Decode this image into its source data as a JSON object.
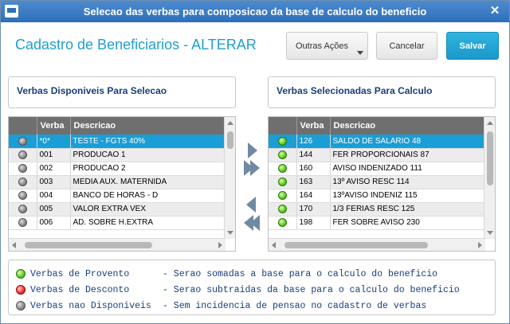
{
  "window": {
    "title": "Selecao das verbas para composicao da base de calculo do beneficio",
    "close_glyph": "✕"
  },
  "header": {
    "title": "Cadastro de Beneficiarios - ALTERAR"
  },
  "buttons": {
    "outras_acoes": "Outras Ações",
    "cancelar": "Cancelar",
    "salvar": "Salvar"
  },
  "left_panel": {
    "label": "Verbas Disponiveis Para Selecao",
    "columns": [
      "",
      "Verba",
      "Descricao"
    ],
    "rows": [
      {
        "status": "gray",
        "verba": "*0*",
        "descricao": "TESTE - FGTS 40%",
        "selected": true
      },
      {
        "status": "gray",
        "verba": "001",
        "descricao": "PRODUCAO 1"
      },
      {
        "status": "gray",
        "verba": "002",
        "descricao": "PRODUCAO 2"
      },
      {
        "status": "gray",
        "verba": "003",
        "descricao": "MEDIA AUX. MATERNIDA"
      },
      {
        "status": "gray",
        "verba": "004",
        "descricao": "BANCO DE HORAS - D"
      },
      {
        "status": "gray",
        "verba": "005",
        "descricao": "VALOR EXTRA VEX"
      },
      {
        "status": "gray",
        "verba": "006",
        "descricao": "AD. SOBRE H.EXTRA"
      }
    ]
  },
  "right_panel": {
    "label": "Verbas Selecionadas Para Calculo",
    "columns": [
      "",
      "Verba",
      "Descricao"
    ],
    "rows": [
      {
        "status": "green",
        "verba": "126",
        "descricao": "SALDO DE SALARIO 48",
        "selected": true
      },
      {
        "status": "green",
        "verba": "144",
        "descricao": "FER PROPORCIONAIS 87"
      },
      {
        "status": "green",
        "verba": "160",
        "descricao": "AVISO INDENIZADO 111"
      },
      {
        "status": "green",
        "verba": "163",
        "descricao": "13º AVISO RESC 114"
      },
      {
        "status": "green",
        "verba": "164",
        "descricao": "13ºAVISO INDENIZ 115"
      },
      {
        "status": "green",
        "verba": "170",
        "descricao": "1/3 FERIAS RESC 125"
      },
      {
        "status": "green",
        "verba": "198",
        "descricao": "FER SOBRE AVISO 230"
      }
    ]
  },
  "movers": [
    "add-one",
    "add-all",
    "remove-one",
    "remove-all"
  ],
  "legend": [
    {
      "color": "green",
      "name": "Verbas de Provento",
      "desc": "- Serao somadas a base para o calculo do beneficio"
    },
    {
      "color": "red",
      "name": "Verbas de Desconto",
      "desc": "- Serao subtraidas da base para o calculo do beneficio"
    },
    {
      "color": "gray",
      "name": "Verbas nao Disponiveis",
      "desc": "- Sem incidencia de pensao no cadastro de verbas"
    }
  ],
  "colors": {
    "accent": "#1e9fd0",
    "titlebar": "#2c6fb8",
    "selection": "#1a9ed6",
    "header_grid": "#6f6f6f"
  }
}
